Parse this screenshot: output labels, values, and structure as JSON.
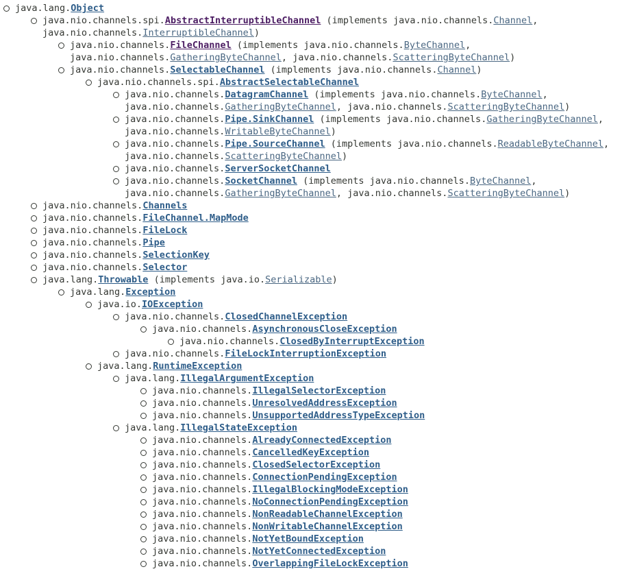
{
  "rows": [
    {
      "indent": 0,
      "b": true,
      "parts": [
        {
          "t": "java.lang."
        },
        {
          "t": "Object",
          "l": "cls"
        }
      ]
    },
    {
      "indent": 1,
      "b": true,
      "parts": [
        {
          "t": "java.nio.channels.spi."
        },
        {
          "t": "AbstractInterruptibleChannel",
          "l": "abs"
        },
        {
          "t": " (implements java.nio.channels."
        },
        {
          "t": "Channel",
          "l": "intf"
        },
        {
          "t": ","
        }
      ]
    },
    {
      "indent": 1,
      "b": false,
      "parts": [
        {
          "t": "java.nio.channels."
        },
        {
          "t": "InterruptibleChannel",
          "l": "intf"
        },
        {
          "t": ")"
        }
      ]
    },
    {
      "indent": 2,
      "b": true,
      "parts": [
        {
          "t": "java.nio.channels."
        },
        {
          "t": "FileChannel",
          "l": "abs"
        },
        {
          "t": " (implements java.nio.channels."
        },
        {
          "t": "ByteChannel",
          "l": "intf"
        },
        {
          "t": ","
        }
      ]
    },
    {
      "indent": 2,
      "b": false,
      "parts": [
        {
          "t": "java.nio.channels."
        },
        {
          "t": "GatheringByteChannel",
          "l": "intf"
        },
        {
          "t": ", java.nio.channels."
        },
        {
          "t": "ScatteringByteChannel",
          "l": "intf"
        },
        {
          "t": ")"
        }
      ]
    },
    {
      "indent": 2,
      "b": true,
      "parts": [
        {
          "t": "java.nio.channels."
        },
        {
          "t": "SelectableChannel",
          "l": "cls"
        },
        {
          "t": " (implements java.nio.channels."
        },
        {
          "t": "Channel",
          "l": "intf"
        },
        {
          "t": ")"
        }
      ]
    },
    {
      "indent": 3,
      "b": true,
      "parts": [
        {
          "t": "java.nio.channels.spi."
        },
        {
          "t": "AbstractSelectableChannel",
          "l": "cls"
        }
      ]
    },
    {
      "indent": 4,
      "b": true,
      "parts": [
        {
          "t": "java.nio.channels."
        },
        {
          "t": "DatagramChannel",
          "l": "cls"
        },
        {
          "t": " (implements java.nio.channels."
        },
        {
          "t": "ByteChannel",
          "l": "intf"
        },
        {
          "t": ","
        }
      ]
    },
    {
      "indent": 4,
      "b": false,
      "parts": [
        {
          "t": "java.nio.channels."
        },
        {
          "t": "GatheringByteChannel",
          "l": "intf"
        },
        {
          "t": ", java.nio.channels."
        },
        {
          "t": "ScatteringByteChannel",
          "l": "intf"
        },
        {
          "t": ")"
        }
      ]
    },
    {
      "indent": 4,
      "b": true,
      "parts": [
        {
          "t": "java.nio.channels."
        },
        {
          "t": "Pipe.SinkChannel",
          "l": "cls"
        },
        {
          "t": " (implements java.nio.channels."
        },
        {
          "t": "GatheringByteChannel",
          "l": "intf"
        },
        {
          "t": ","
        }
      ]
    },
    {
      "indent": 4,
      "b": false,
      "parts": [
        {
          "t": "java.nio.channels."
        },
        {
          "t": "WritableByteChannel",
          "l": "intf"
        },
        {
          "t": ")"
        }
      ]
    },
    {
      "indent": 4,
      "b": true,
      "parts": [
        {
          "t": "java.nio.channels."
        },
        {
          "t": "Pipe.SourceChannel",
          "l": "cls"
        },
        {
          "t": " (implements java.nio.channels."
        },
        {
          "t": "ReadableByteChannel",
          "l": "intf"
        },
        {
          "t": ","
        }
      ]
    },
    {
      "indent": 4,
      "b": false,
      "parts": [
        {
          "t": "java.nio.channels."
        },
        {
          "t": "ScatteringByteChannel",
          "l": "intf"
        },
        {
          "t": ")"
        }
      ]
    },
    {
      "indent": 4,
      "b": true,
      "parts": [
        {
          "t": "java.nio.channels."
        },
        {
          "t": "ServerSocketChannel",
          "l": "cls"
        }
      ]
    },
    {
      "indent": 4,
      "b": true,
      "parts": [
        {
          "t": "java.nio.channels."
        },
        {
          "t": "SocketChannel",
          "l": "cls"
        },
        {
          "t": " (implements java.nio.channels."
        },
        {
          "t": "ByteChannel",
          "l": "intf"
        },
        {
          "t": ","
        }
      ]
    },
    {
      "indent": 4,
      "b": false,
      "parts": [
        {
          "t": "java.nio.channels."
        },
        {
          "t": "GatheringByteChannel",
          "l": "intf"
        },
        {
          "t": ", java.nio.channels."
        },
        {
          "t": "ScatteringByteChannel",
          "l": "intf"
        },
        {
          "t": ")"
        }
      ]
    },
    {
      "indent": 1,
      "b": true,
      "parts": [
        {
          "t": "java.nio.channels."
        },
        {
          "t": "Channels",
          "l": "cls"
        }
      ]
    },
    {
      "indent": 1,
      "b": true,
      "parts": [
        {
          "t": "java.nio.channels."
        },
        {
          "t": "FileChannel.MapMode",
          "l": "cls"
        }
      ]
    },
    {
      "indent": 1,
      "b": true,
      "parts": [
        {
          "t": "java.nio.channels."
        },
        {
          "t": "FileLock",
          "l": "cls"
        }
      ]
    },
    {
      "indent": 1,
      "b": true,
      "parts": [
        {
          "t": "java.nio.channels."
        },
        {
          "t": "Pipe",
          "l": "cls"
        }
      ]
    },
    {
      "indent": 1,
      "b": true,
      "parts": [
        {
          "t": "java.nio.channels."
        },
        {
          "t": "SelectionKey",
          "l": "cls"
        }
      ]
    },
    {
      "indent": 1,
      "b": true,
      "parts": [
        {
          "t": "java.nio.channels."
        },
        {
          "t": "Selector",
          "l": "cls"
        }
      ]
    },
    {
      "indent": 1,
      "b": true,
      "parts": [
        {
          "t": "java.lang."
        },
        {
          "t": "Throwable",
          "l": "cls"
        },
        {
          "t": " (implements java.io."
        },
        {
          "t": "Serializable",
          "l": "intf"
        },
        {
          "t": ")"
        }
      ]
    },
    {
      "indent": 2,
      "b": true,
      "parts": [
        {
          "t": "java.lang."
        },
        {
          "t": "Exception",
          "l": "cls"
        }
      ]
    },
    {
      "indent": 3,
      "b": true,
      "parts": [
        {
          "t": "java.io."
        },
        {
          "t": "IOException",
          "l": "cls"
        }
      ]
    },
    {
      "indent": 4,
      "b": true,
      "parts": [
        {
          "t": "java.nio.channels."
        },
        {
          "t": "ClosedChannelException",
          "l": "cls"
        }
      ]
    },
    {
      "indent": 5,
      "b": true,
      "parts": [
        {
          "t": "java.nio.channels."
        },
        {
          "t": "AsynchronousCloseException",
          "l": "cls"
        }
      ]
    },
    {
      "indent": 6,
      "b": true,
      "parts": [
        {
          "t": "java.nio.channels."
        },
        {
          "t": "ClosedByInterruptException",
          "l": "cls"
        }
      ]
    },
    {
      "indent": 4,
      "b": true,
      "parts": [
        {
          "t": "java.nio.channels."
        },
        {
          "t": "FileLockInterruptionException",
          "l": "cls"
        }
      ]
    },
    {
      "indent": 3,
      "b": true,
      "parts": [
        {
          "t": "java.lang."
        },
        {
          "t": "RuntimeException",
          "l": "cls"
        }
      ]
    },
    {
      "indent": 4,
      "b": true,
      "parts": [
        {
          "t": "java.lang."
        },
        {
          "t": "IllegalArgumentException",
          "l": "cls"
        }
      ]
    },
    {
      "indent": 5,
      "b": true,
      "parts": [
        {
          "t": "java.nio.channels."
        },
        {
          "t": "IllegalSelectorException",
          "l": "cls"
        }
      ]
    },
    {
      "indent": 5,
      "b": true,
      "parts": [
        {
          "t": "java.nio.channels."
        },
        {
          "t": "UnresolvedAddressException",
          "l": "cls"
        }
      ]
    },
    {
      "indent": 5,
      "b": true,
      "parts": [
        {
          "t": "java.nio.channels."
        },
        {
          "t": "UnsupportedAddressTypeException",
          "l": "cls"
        }
      ]
    },
    {
      "indent": 4,
      "b": true,
      "parts": [
        {
          "t": "java.lang."
        },
        {
          "t": "IllegalStateException",
          "l": "cls"
        }
      ]
    },
    {
      "indent": 5,
      "b": true,
      "parts": [
        {
          "t": "java.nio.channels."
        },
        {
          "t": "AlreadyConnectedException",
          "l": "cls"
        }
      ]
    },
    {
      "indent": 5,
      "b": true,
      "parts": [
        {
          "t": "java.nio.channels."
        },
        {
          "t": "CancelledKeyException",
          "l": "cls"
        }
      ]
    },
    {
      "indent": 5,
      "b": true,
      "parts": [
        {
          "t": "java.nio.channels."
        },
        {
          "t": "ClosedSelectorException",
          "l": "cls"
        }
      ]
    },
    {
      "indent": 5,
      "b": true,
      "parts": [
        {
          "t": "java.nio.channels."
        },
        {
          "t": "ConnectionPendingException",
          "l": "cls"
        }
      ]
    },
    {
      "indent": 5,
      "b": true,
      "parts": [
        {
          "t": "java.nio.channels."
        },
        {
          "t": "IllegalBlockingModeException",
          "l": "cls"
        }
      ]
    },
    {
      "indent": 5,
      "b": true,
      "parts": [
        {
          "t": "java.nio.channels."
        },
        {
          "t": "NoConnectionPendingException",
          "l": "cls"
        }
      ]
    },
    {
      "indent": 5,
      "b": true,
      "parts": [
        {
          "t": "java.nio.channels."
        },
        {
          "t": "NonReadableChannelException",
          "l": "cls"
        }
      ]
    },
    {
      "indent": 5,
      "b": true,
      "parts": [
        {
          "t": "java.nio.channels."
        },
        {
          "t": "NonWritableChannelException",
          "l": "cls"
        }
      ]
    },
    {
      "indent": 5,
      "b": true,
      "parts": [
        {
          "t": "java.nio.channels."
        },
        {
          "t": "NotYetBoundException",
          "l": "cls"
        }
      ]
    },
    {
      "indent": 5,
      "b": true,
      "parts": [
        {
          "t": "java.nio.channels."
        },
        {
          "t": "NotYetConnectedException",
          "l": "cls"
        }
      ]
    },
    {
      "indent": 5,
      "b": true,
      "parts": [
        {
          "t": "java.nio.channels."
        },
        {
          "t": "OverlappingFileLockException",
          "l": "cls"
        }
      ]
    }
  ]
}
